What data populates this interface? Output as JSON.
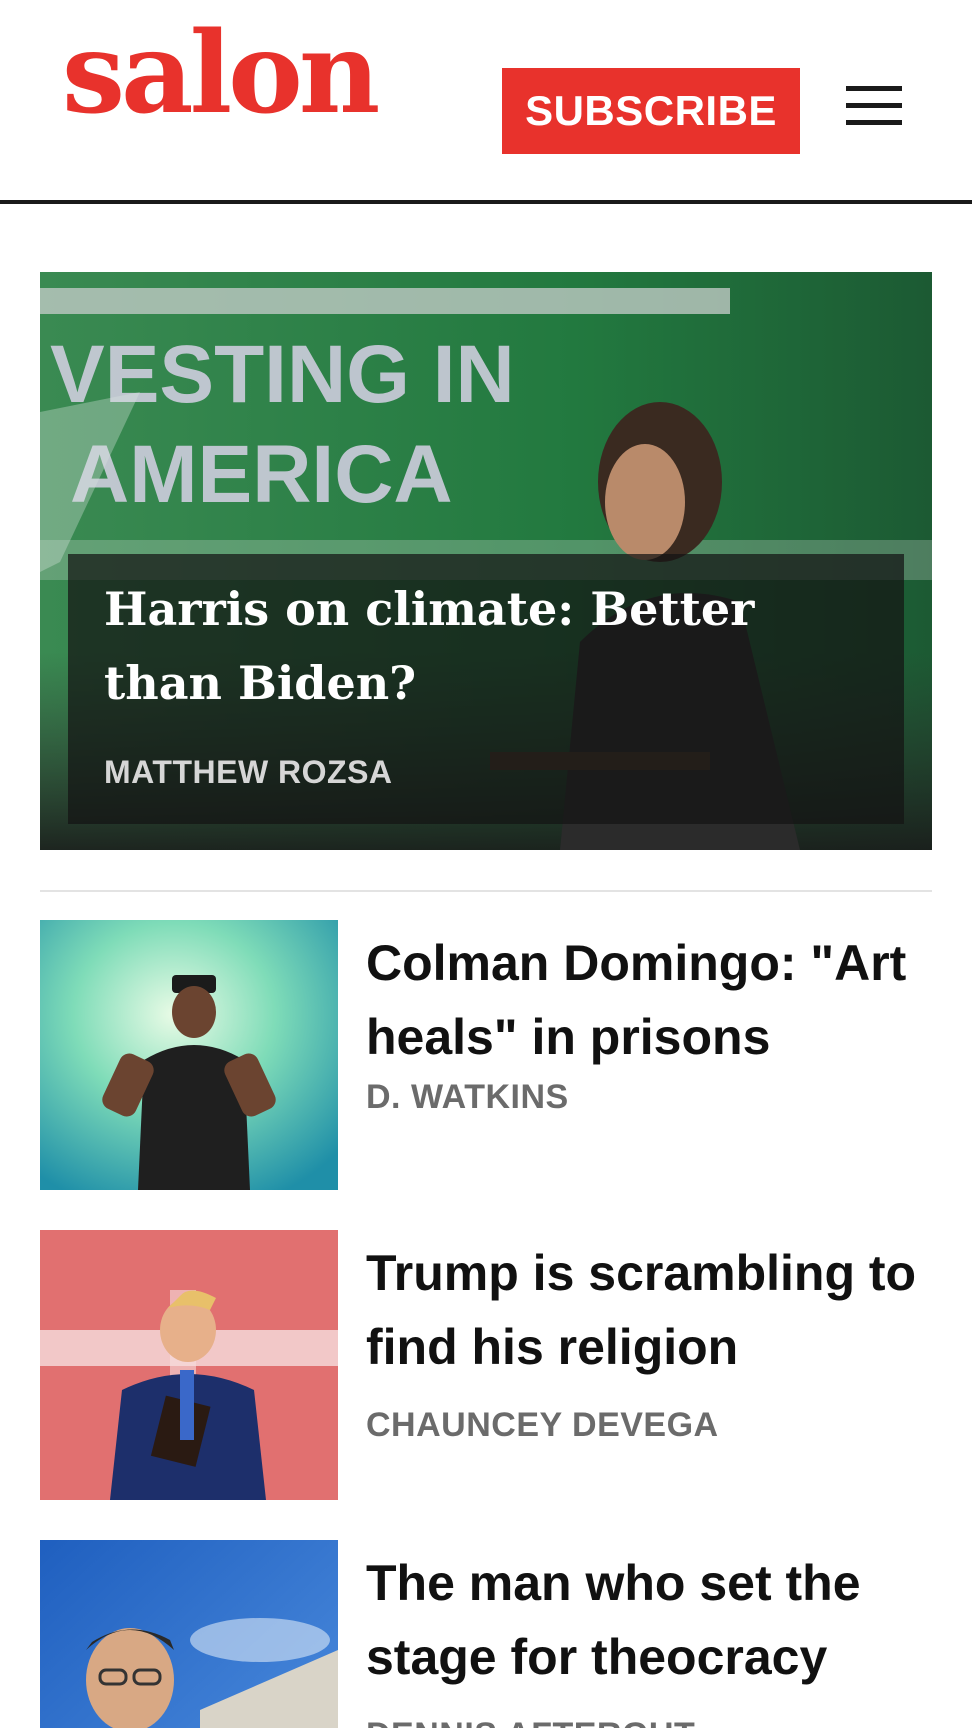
{
  "header": {
    "logo_text": "salon",
    "subscribe_label": "SUBSCRIBE",
    "menu_icon": "hamburger-menu-icon",
    "brand_color": "#e8322c"
  },
  "hero": {
    "title": "Harris on climate: Better than Biden?",
    "author": "MATTHEW ROZSA",
    "image_sign_text_line1": "VESTING IN",
    "image_sign_text_line2": "AMERICA"
  },
  "articles": [
    {
      "title": "Colman Domingo: \"Art heals\" in prisons",
      "author": "D. WATKINS"
    },
    {
      "title": "Trump is scrambling to find his religion",
      "author": "CHAUNCEY DEVEGA"
    },
    {
      "title": "The man who set the stage for theocracy",
      "author": "DENNIS AFTERGUT"
    }
  ]
}
